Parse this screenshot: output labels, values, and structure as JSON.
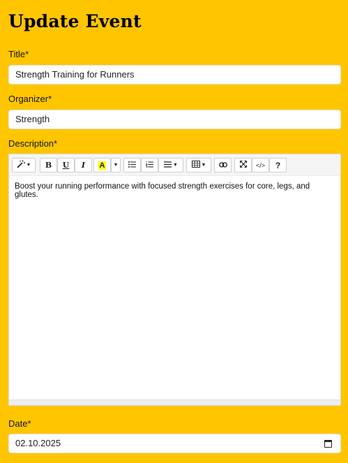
{
  "header": {
    "title": "Update Event"
  },
  "form": {
    "title_label": "Title*",
    "title_value": "Strength Training for Runners",
    "organizer_label": "Organizer*",
    "organizer_value": "Strength",
    "description_label": "Description*",
    "description_text": "Boost your running performance with focused strength exercises for core, legs, and glutes.",
    "date_label": "Date*",
    "date_value": "02.10.2025"
  },
  "toolbar": {
    "bold": "B",
    "underline": "U",
    "italic": "I",
    "highlight": "A",
    "code": "</>",
    "help": "?"
  },
  "icons": [
    "magic-icon",
    "bold-icon",
    "underline-icon",
    "italic-icon",
    "highlight-icon",
    "bullet-list-icon",
    "numbered-list-icon",
    "align-icon",
    "table-icon",
    "link-icon",
    "fullscreen-icon",
    "code-view-icon",
    "help-icon",
    "calendar-icon"
  ],
  "colors": {
    "background": "#ffc600",
    "highlight": "#ffff00"
  }
}
